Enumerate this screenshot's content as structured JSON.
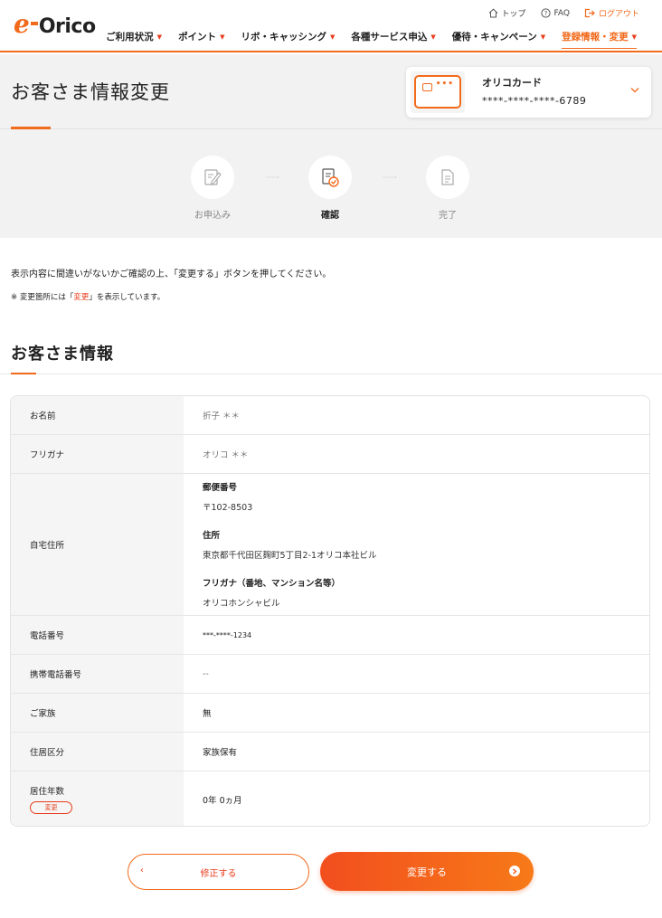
{
  "header": {
    "logo": {
      "e": "e",
      "brand": "Orico"
    },
    "utility": [
      {
        "icon": "home-icon",
        "label": "トップ"
      },
      {
        "icon": "help-icon",
        "label": "FAQ"
      },
      {
        "icon": "logout-icon",
        "label": "ログアウト"
      }
    ],
    "nav": [
      {
        "label": "ご利用状況"
      },
      {
        "label": "ポイント"
      },
      {
        "label": "リボ・キャッシング"
      },
      {
        "label": "各種サービス申込"
      },
      {
        "label": "優待・キャンペーン"
      },
      {
        "label": "登録情報・変更",
        "active": true
      }
    ]
  },
  "page": {
    "title": "お客さま情報変更"
  },
  "card": {
    "name": "オリコカード",
    "number": "****-****-****-6789"
  },
  "steps": [
    {
      "label": "お申込み",
      "state": "done"
    },
    {
      "label": "確認",
      "state": "current"
    },
    {
      "label": "完了",
      "state": "pending"
    }
  ],
  "notice": {
    "text": "表示内容に間違いがないかご確認の上、「変更する」ボタンを押してください。",
    "note_prefix": "※ 変更箇所には「",
    "note_highlight": "変更",
    "note_suffix": "」を表示しています。"
  },
  "section": {
    "title": "お客さま情報"
  },
  "info": {
    "name": {
      "label": "お名前",
      "value": "折子 ＊＊"
    },
    "kana": {
      "label": "フリガナ",
      "value": "オリコ ＊＊"
    },
    "address": {
      "label": "自宅住所",
      "postal_label": "郵便番号",
      "postal_value": "〒102-8503",
      "addr_label": "住所",
      "addr_value": "東京都千代田区麹町5丁目2-1オリコ本社ビル",
      "kana_label": "フリガナ（番地、マンション名等）",
      "kana_value": "オリコホンシャビル"
    },
    "phone": {
      "label": "電話番号",
      "value": "***-****-1234"
    },
    "mobile": {
      "label": "携帯電話番号",
      "value": "--"
    },
    "family": {
      "label": "ご家族",
      "value": "無"
    },
    "housing": {
      "label": "住居区分",
      "value": "家族保有"
    },
    "residence": {
      "label": "居住年数",
      "badge": "変更",
      "value": "0年 0ヵ月"
    }
  },
  "buttons": {
    "back": "修正する",
    "submit": "変更する"
  },
  "colors": {
    "accent": "#f26a1b",
    "accent_red": "#e83c1c"
  }
}
